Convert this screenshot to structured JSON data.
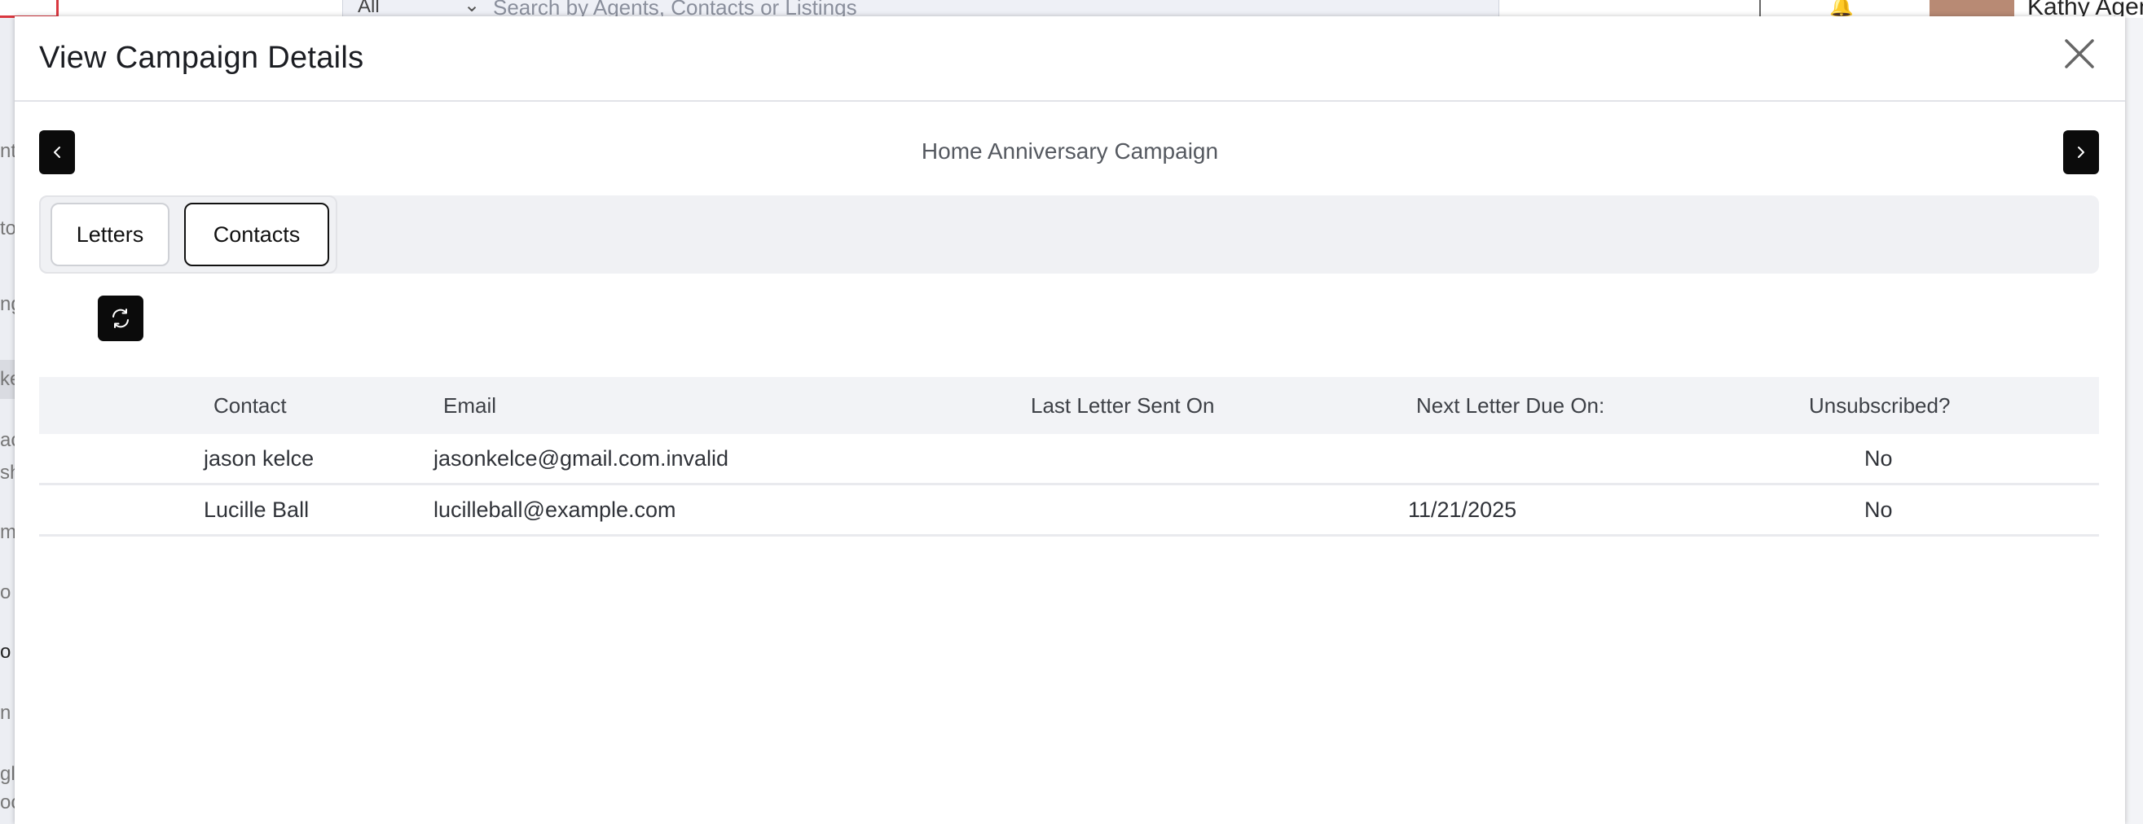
{
  "background": {
    "search_filter": "All",
    "search_placeholder": "Search by Agents, Contacts or Listings",
    "user_name": "Kathy Agent",
    "sidebar_fragments": [
      "nt",
      "to",
      "ng",
      "ke",
      "ac",
      "sh",
      "m",
      "o",
      "o",
      "n",
      "gl",
      "oc"
    ]
  },
  "modal": {
    "title": "View Campaign Details",
    "campaign_name": "Home Anniversary Campaign",
    "tabs": [
      {
        "label": "Letters",
        "active": false
      },
      {
        "label": "Contacts",
        "active": true
      }
    ],
    "table": {
      "headers": {
        "contact": "Contact",
        "email": "Email",
        "last_sent": "Last Letter Sent On",
        "next_due": "Next Letter Due On:",
        "unsubscribed": "Unsubscribed?"
      },
      "rows": [
        {
          "contact": "jason kelce",
          "email": "jasonkelce@gmail.com.invalid",
          "last_sent": "",
          "next_due": "",
          "unsubscribed": "No"
        },
        {
          "contact": "Lucille Ball",
          "email": "lucilleball@example.com",
          "last_sent": "",
          "next_due": "11/21/2025",
          "unsubscribed": "No"
        }
      ]
    }
  },
  "icons": {
    "close": "close-icon",
    "prev": "chevron-left-icon",
    "next": "chevron-right-icon",
    "refresh": "refresh-icon"
  },
  "colors": {
    "button_dark": "#0b0b0b",
    "tabbar_bg": "#f0f1f4",
    "table_header_bg": "#f2f3f6",
    "brand_red": "#d9373f"
  }
}
